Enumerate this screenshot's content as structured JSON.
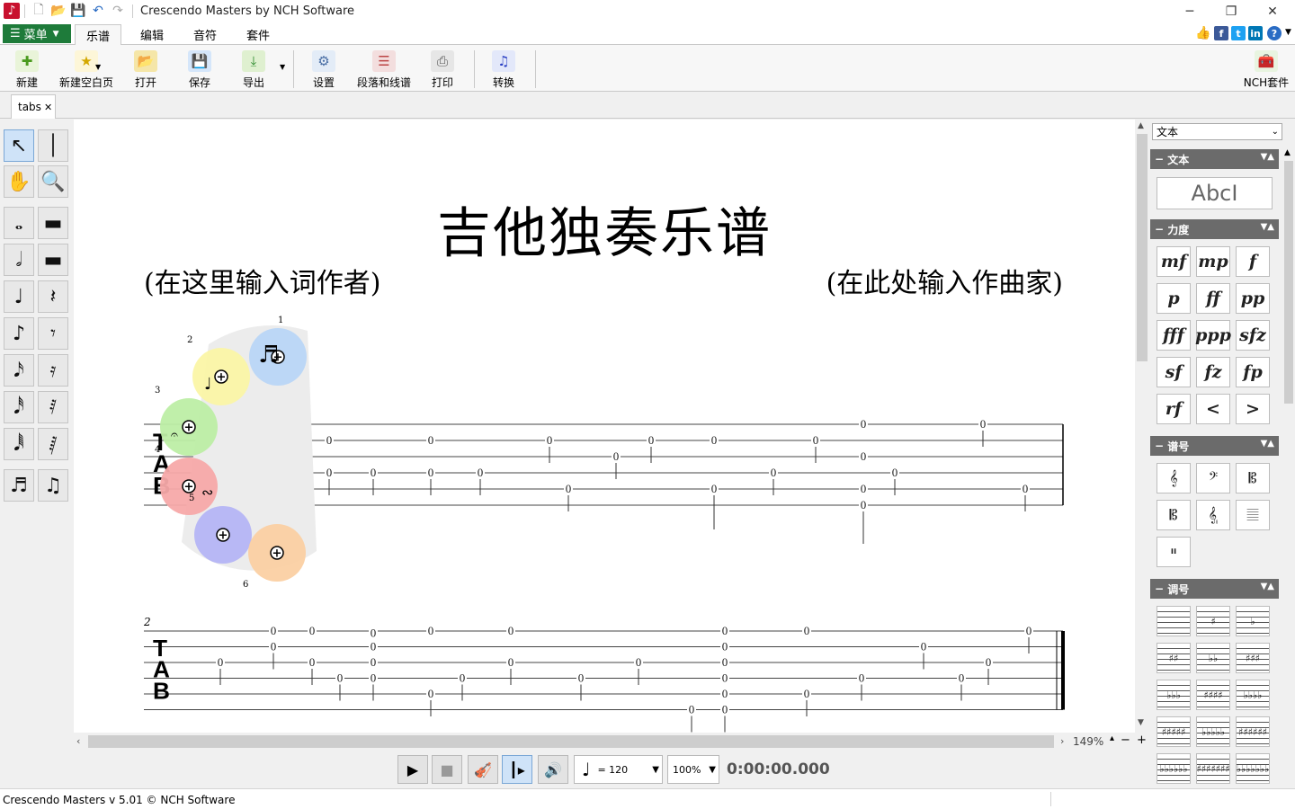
{
  "window": {
    "title": "Crescendo Masters by NCH Software",
    "controls": {
      "minimize": "─",
      "restore": "❐",
      "close": "✕"
    }
  },
  "menubar": {
    "menu_label": "菜单",
    "tabs": [
      {
        "label": "乐谱",
        "active": true
      },
      {
        "label": "编辑",
        "active": false
      },
      {
        "label": "音符",
        "active": false
      },
      {
        "label": "套件",
        "active": false
      }
    ]
  },
  "ribbon": {
    "buttons": [
      {
        "label": "新建",
        "icon": "new-doc-icon"
      },
      {
        "label": "新建空白页",
        "icon": "new-blank-icon"
      },
      {
        "label": "打开",
        "icon": "open-folder-icon"
      },
      {
        "label": "保存",
        "icon": "save-icon"
      },
      {
        "label": "导出",
        "icon": "export-icon"
      },
      {
        "label": "设置",
        "icon": "settings-icon"
      },
      {
        "label": "段落和线谱",
        "icon": "staves-icon"
      },
      {
        "label": "打印",
        "icon": "print-icon"
      },
      {
        "label": "转换",
        "icon": "convert-icon"
      }
    ],
    "nch_suite": "NCH套件"
  },
  "doc_tab": {
    "label": "tabs"
  },
  "score": {
    "title": "吉他独奏乐谱",
    "lyricist": "(在这里输入词作者)",
    "composer": "(在此处输入作曲家)",
    "measure_number": "2",
    "tab_letters": [
      "T",
      "A",
      "B"
    ],
    "fret_glyph": "0",
    "string_numbers": [
      "1",
      "2",
      "3",
      "4",
      "5",
      "6"
    ]
  },
  "transport": {
    "tempo_symbol": "♩",
    "tempo_value": "= 120",
    "zoom_playback": "100%",
    "time": "0:00:00.000"
  },
  "zoom": {
    "value": "149%"
  },
  "status": {
    "text": "Crescendo Masters v 5.01 © NCH Software"
  },
  "right_panel": {
    "category": "文本",
    "sections": {
      "text": {
        "title": "文本",
        "button": "AbcI"
      },
      "dynamics": {
        "title": "力度",
        "items": [
          "mf",
          "mp",
          "f",
          "p",
          "ff",
          "pp",
          "fff",
          "ppp",
          "sfz",
          "sf",
          "fz",
          "fp",
          "rf",
          "<",
          ">"
        ]
      },
      "clefs": {
        "title": "谱号",
        "items": [
          "𝄞",
          "𝄢",
          "𝄡",
          "𝄡",
          "𝄠",
          "𝄚",
          "𝄥"
        ]
      },
      "keysigs": {
        "title": "调号",
        "items": [
          "",
          "♯",
          "♭",
          "♯♯",
          "♭♭",
          "♯♯♯",
          "♭♭♭",
          "♯♯♯♯",
          "♭♭♭♭",
          "♯♯♯♯♯",
          "♭♭♭♭♭",
          "♯♯♯♯♯♯",
          "♭♭♭♭♭♭",
          "♯♯♯♯♯♯♯",
          "♭♭♭♭♭♭♭"
        ]
      }
    }
  }
}
